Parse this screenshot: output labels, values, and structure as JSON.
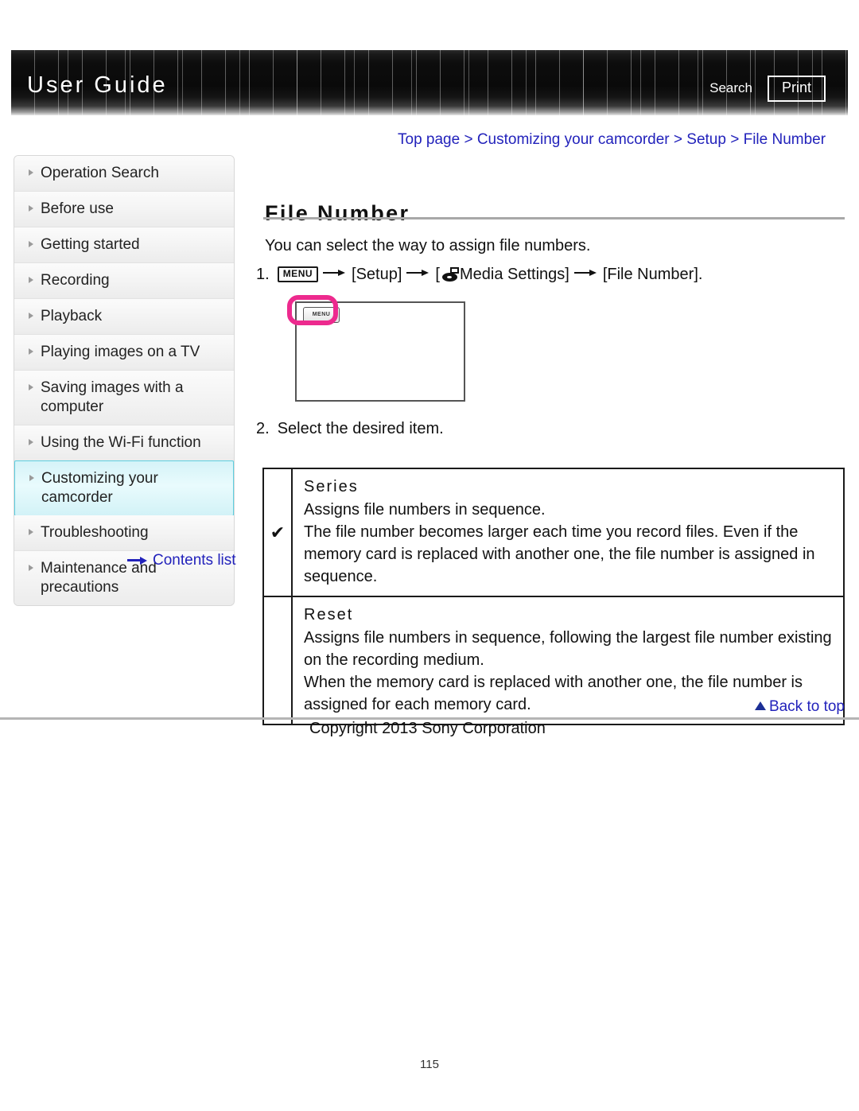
{
  "header": {
    "title": "User Guide",
    "search_label": "Search",
    "print_label": "Print"
  },
  "sidebar": {
    "items": [
      {
        "label": "Operation Search",
        "active": false
      },
      {
        "label": "Before use",
        "active": false
      },
      {
        "label": "Getting started",
        "active": false
      },
      {
        "label": "Recording",
        "active": false
      },
      {
        "label": "Playback",
        "active": false
      },
      {
        "label": "Playing images on a TV",
        "active": false
      },
      {
        "label": "Saving images with a computer",
        "active": false
      },
      {
        "label": "Using the Wi-Fi function",
        "active": false
      },
      {
        "label": "Customizing your camcorder",
        "active": true
      },
      {
        "label": "Troubleshooting",
        "active": false
      },
      {
        "label": "Maintenance and precautions",
        "active": false
      }
    ],
    "contents_list_label": "Contents list"
  },
  "breadcrumb": {
    "text": "Top page > Customizing your camcorder > Setup > File Number"
  },
  "main": {
    "page_title": "File Number",
    "intro": "You can select the way to assign file numbers.",
    "step1": {
      "number": "1.",
      "menu_chip": "MENU",
      "part_setup": "[Setup]",
      "part_media": "Media Settings]",
      "part_media_open_bracket": "[",
      "part_file_number": "[File Number]."
    },
    "screen_illustration": {
      "menu_button_label": "MENU"
    },
    "step2": {
      "number": "2.",
      "text": "Select the desired item."
    },
    "options": [
      {
        "mark": "✔",
        "name": "Series",
        "description": "Assigns file numbers in sequence.\nThe file number becomes larger each time you record files. Even if the memory card is replaced with another one, the file number is assigned in sequence."
      },
      {
        "mark": "",
        "name": "Reset",
        "description": "Assigns file numbers in sequence, following the largest file number existing on the recording medium.\nWhen the memory card is replaced with another one, the file number is assigned for each memory card."
      }
    ]
  },
  "footer": {
    "back_to_top_label": "Back to top",
    "copyright": "Copyright 2013 Sony Corporation",
    "page_number": "115"
  },
  "colors": {
    "link_blue": "#2222bb",
    "highlight_cyan": "#5ecfe0",
    "accent_magenta": "#ed2a8e"
  }
}
